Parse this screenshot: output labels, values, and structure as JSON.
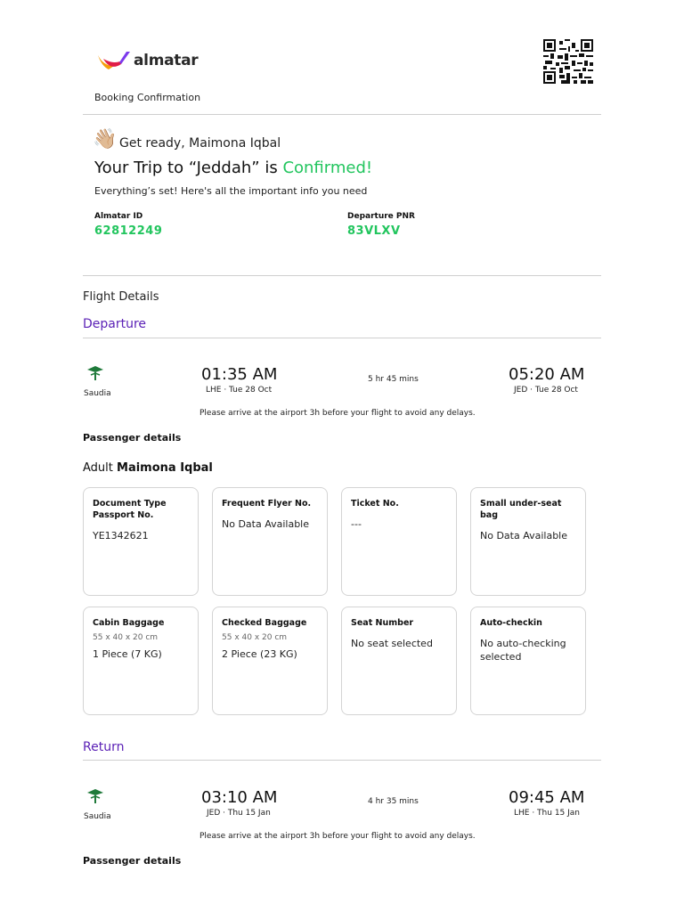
{
  "header": {
    "brand": "almatar",
    "subtitle": "Booking Confirmation"
  },
  "greeting": {
    "text": "Get ready, Maimona Iqbal",
    "icon": "waving-hand-icon"
  },
  "headline": {
    "prefix": "Your Trip to “Jeddah” is ",
    "status": "Confirmed!"
  },
  "intro": "Everything’s set! Here's all the important info you need",
  "ids": {
    "almatar_label": "Almatar ID",
    "almatar_value": "62812249",
    "pnr_label": "Departure PNR",
    "pnr_value": "83VLXV"
  },
  "flight_details_title": "Flight Details",
  "departure": {
    "title": "Departure",
    "airline": "Saudia",
    "dep_time": "01:35 AM",
    "dep_place": "LHE · Tue 28 Oct",
    "duration": "5 hr 45 mins",
    "arr_time": "05:20 AM",
    "arr_place": "JED · Tue 28 Oct",
    "note": "Please arrive at the airport 3h before your flight to avoid any delays.",
    "pax_title": "Passenger details"
  },
  "passenger": {
    "type": "Adult",
    "name": "Maimona Iqbal"
  },
  "cards": {
    "doc_title1": "Document Type",
    "doc_title2": "Passport No.",
    "doc_value": "YE1342621",
    "ff_title": "Frequent Flyer No.",
    "ff_value": "No Data Available",
    "ticket_title": "Ticket No.",
    "ticket_value": "---",
    "small_bag_title": "Small under-seat bag",
    "small_bag_value": "No Data Available",
    "cabin_title": "Cabin Baggage",
    "cabin_dims": "55 x 40 x 20 cm",
    "cabin_value": "1 Piece (7 KG)",
    "checked_title": "Checked Baggage",
    "checked_dims": "55 x 40 x 20 cm",
    "checked_value": "2 Piece (23 KG)",
    "seat_title": "Seat Number",
    "seat_value": "No seat selected",
    "auto_title": "Auto-checkin",
    "auto_value": "No auto-checking selected"
  },
  "return": {
    "title": "Return",
    "airline": "Saudia",
    "dep_time": "03:10 AM",
    "dep_place": "JED · Thu 15 Jan",
    "duration": "4 hr 35 mins",
    "arr_time": "09:45 AM",
    "arr_place": "LHE · Thu 15 Jan",
    "note": "Please arrive at the airport 3h before your flight to avoid any delays.",
    "pax_title": "Passenger details"
  },
  "colors": {
    "confirmed_green": "#22c55e",
    "leg_purple": "#5b21b6",
    "logo_red": "#e11d48",
    "logo_yellow": "#f59e0b",
    "logo_purple": "#7c3aed",
    "saudia_green": "#1f7a3a"
  }
}
